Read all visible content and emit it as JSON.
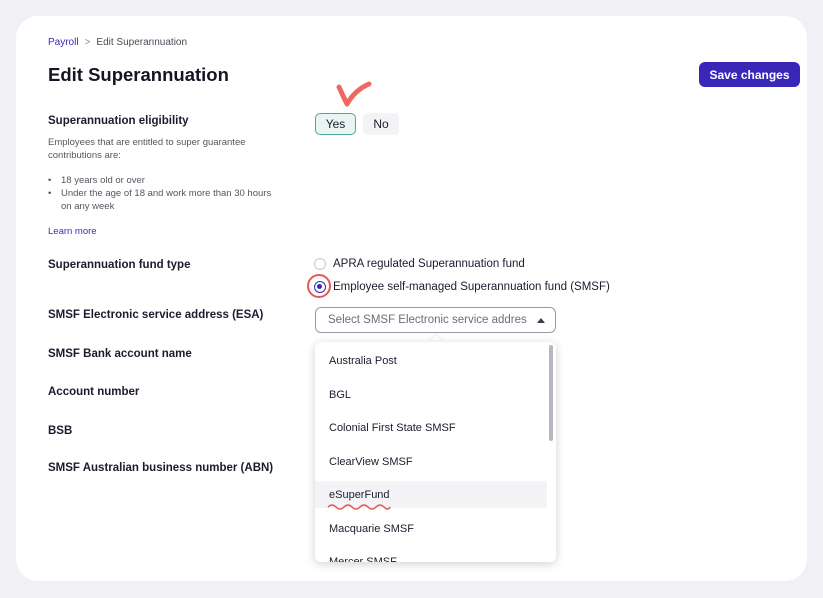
{
  "breadcrumb": {
    "parent": "Payroll",
    "separator": ">",
    "current": "Edit Superannuation"
  },
  "page_title": "Edit Superannuation",
  "save_button": "Save changes",
  "eligibility": {
    "label": "Superannuation eligibility",
    "description": "Employees that are entitled to super guarantee contributions are:",
    "bullets": [
      "18 years old or over",
      "Under the age of 18 and work more than 30 hours on any week"
    ],
    "learn_more": "Learn more",
    "yes": "Yes",
    "no": "No",
    "selected": "Yes"
  },
  "fund_type": {
    "label": "Superannuation fund type",
    "options": [
      {
        "label": "APRA regulated Superannuation fund",
        "checked": false
      },
      {
        "label": "Employee self-managed Superannuation fund (SMSF)",
        "checked": true
      }
    ]
  },
  "fields": {
    "esa": "SMSF Electronic service address (ESA)",
    "bank_account_name": "SMSF Bank account name",
    "account_number": "Account number",
    "bsb": "BSB",
    "abn": "SMSF Australian business number (ABN)"
  },
  "esa_select": {
    "placeholder": "Select SMSF Electronic service addres",
    "options": [
      "Australia Post",
      "BGL",
      "Colonial First State SMSF",
      "ClearView SMSF",
      "eSuperFund",
      "Macquarie SMSF",
      "Mercer SMSF"
    ],
    "hovered": "eSuperFund"
  },
  "colors": {
    "accent": "#3a27b8",
    "link": "#3a2fb5",
    "annotation": "#e6574f",
    "yes_border": "#4fa5a0"
  },
  "icons": {
    "check": "check-annotation-icon",
    "caret": "caret-up-icon",
    "chevron": "chevron-right-icon"
  }
}
